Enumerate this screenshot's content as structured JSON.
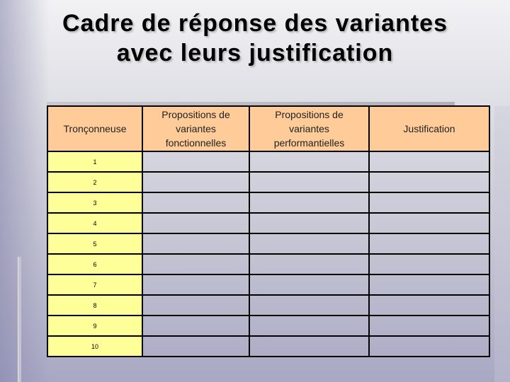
{
  "title": {
    "line1": "Cadre de réponse des variantes",
    "line2": "avec leurs justification"
  },
  "table": {
    "headers": [
      {
        "lines": [
          "Tronçonneuse"
        ]
      },
      {
        "lines": [
          "Propositions de",
          "variantes",
          "fonctionnelles"
        ]
      },
      {
        "lines": [
          "Propositions de",
          "variantes",
          "performantielles"
        ]
      },
      {
        "lines": [
          "Justification"
        ]
      }
    ],
    "rows": [
      {
        "label": "1",
        "cells": [
          "",
          "",
          ""
        ]
      },
      {
        "label": "2",
        "cells": [
          "",
          "",
          ""
        ]
      },
      {
        "label": "3",
        "cells": [
          "",
          "",
          ""
        ]
      },
      {
        "label": "4",
        "cells": [
          "",
          "",
          ""
        ]
      },
      {
        "label": "5",
        "cells": [
          "",
          "",
          ""
        ]
      },
      {
        "label": "6",
        "cells": [
          "",
          "",
          ""
        ]
      },
      {
        "label": "7",
        "cells": [
          "",
          "",
          ""
        ]
      },
      {
        "label": "8",
        "cells": [
          "",
          "",
          ""
        ]
      },
      {
        "label": "9",
        "cells": [
          "",
          "",
          ""
        ]
      },
      {
        "label": "10",
        "cells": [
          "",
          "",
          ""
        ]
      }
    ]
  },
  "colors": {
    "header_fill": "#ffcc99",
    "number_fill": "#ffff99",
    "border": "#000000"
  }
}
